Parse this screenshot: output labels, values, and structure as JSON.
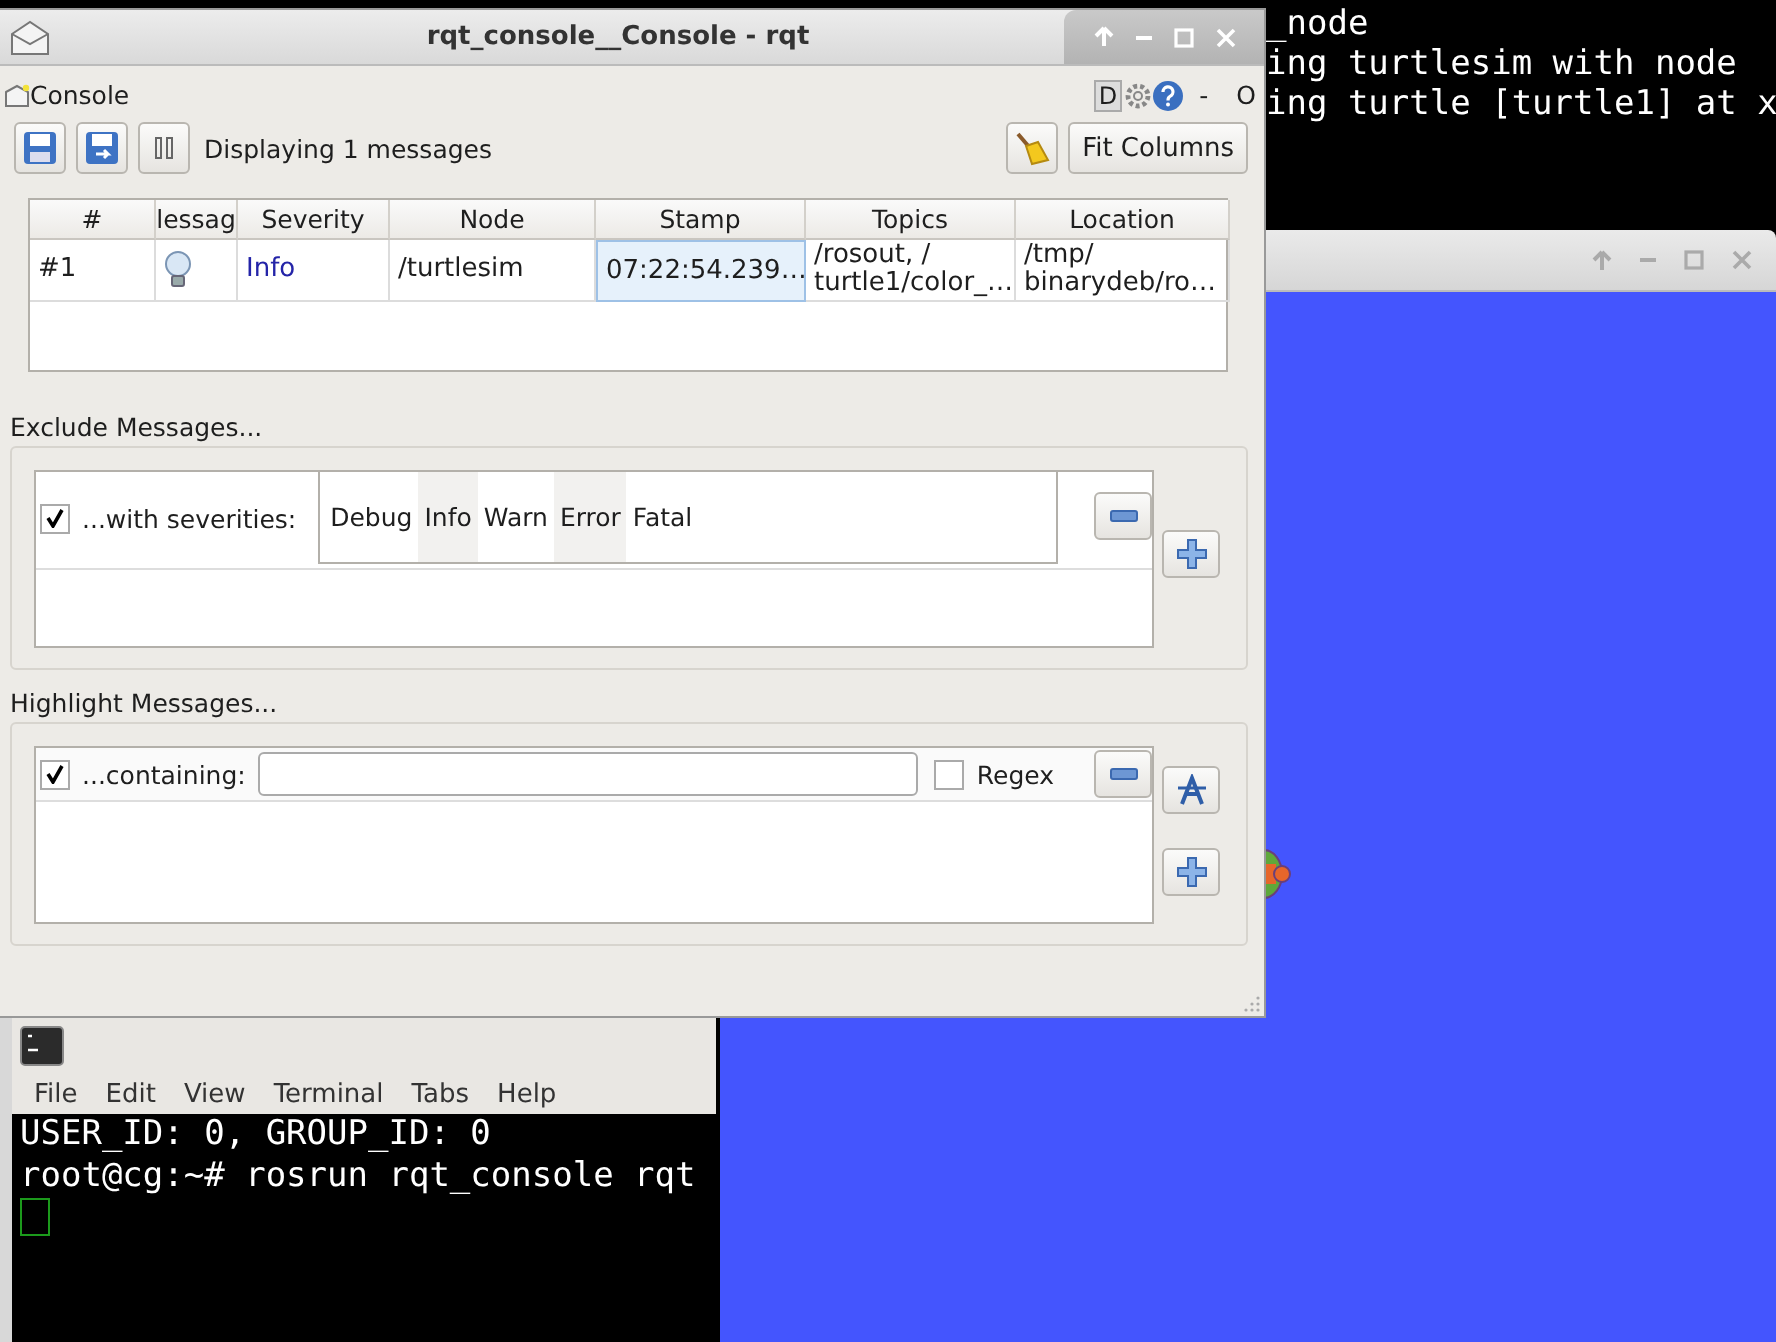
{
  "background_terminal": {
    "lines": [
      "_node",
      "ing turtlesim with node",
      "ing turtle [turtle1] at x"
    ]
  },
  "rqt_window": {
    "title": "rqt_console__Console - rqt",
    "plugin": {
      "title": "Console",
      "badge": "D",
      "trailing": [
        "-",
        "O"
      ]
    },
    "toolbar": {
      "status": "Displaying 1 messages",
      "fit_button": "Fit Columns"
    },
    "table": {
      "columns": [
        "#",
        "lessag",
        "Severity",
        "Node",
        "Stamp",
        "Topics",
        "Location"
      ],
      "rows": [
        {
          "cells": [
            {
              "kind": "text",
              "lines": [
                "#1"
              ],
              "selected": false
            },
            {
              "kind": "icon",
              "selected": false
            },
            {
              "kind": "severity",
              "lines": [
                "Info"
              ],
              "selected": false
            },
            {
              "kind": "text",
              "lines": [
                "/turtlesim"
              ],
              "selected": false
            },
            {
              "kind": "text",
              "lines": [
                "07:22:54.239…"
              ],
              "selected": true
            },
            {
              "kind": "text",
              "lines": [
                "/rosout, /",
                "turtle1/color_…"
              ],
              "selected": false
            },
            {
              "kind": "text",
              "lines": [
                "/tmp/",
                "binarydeb/ro…"
              ],
              "selected": false
            }
          ]
        }
      ]
    },
    "exclude": {
      "title": "Exclude Messages...",
      "filters": [
        {
          "checked": true,
          "label": "...with severities:",
          "severities": [
            {
              "label": "Debug",
              "selected": false
            },
            {
              "label": "Info",
              "selected": true
            },
            {
              "label": "Warn",
              "selected": false
            },
            {
              "label": "Error",
              "selected": true
            },
            {
              "label": "Fatal",
              "selected": false
            }
          ]
        }
      ]
    },
    "highlight": {
      "title": "Highlight Messages...",
      "filters": [
        {
          "checked": true,
          "label": "...containing:",
          "regex": {
            "label": "Regex",
            "checked": false
          }
        }
      ]
    }
  },
  "terminal_window": {
    "menu": [
      "File",
      "Edit",
      "View",
      "Terminal",
      "Tabs",
      "Help"
    ],
    "lines": [
      "USER_ID: 0, GROUP_ID: 0",
      "root@cg:~# rosrun rqt_console rqt"
    ]
  }
}
